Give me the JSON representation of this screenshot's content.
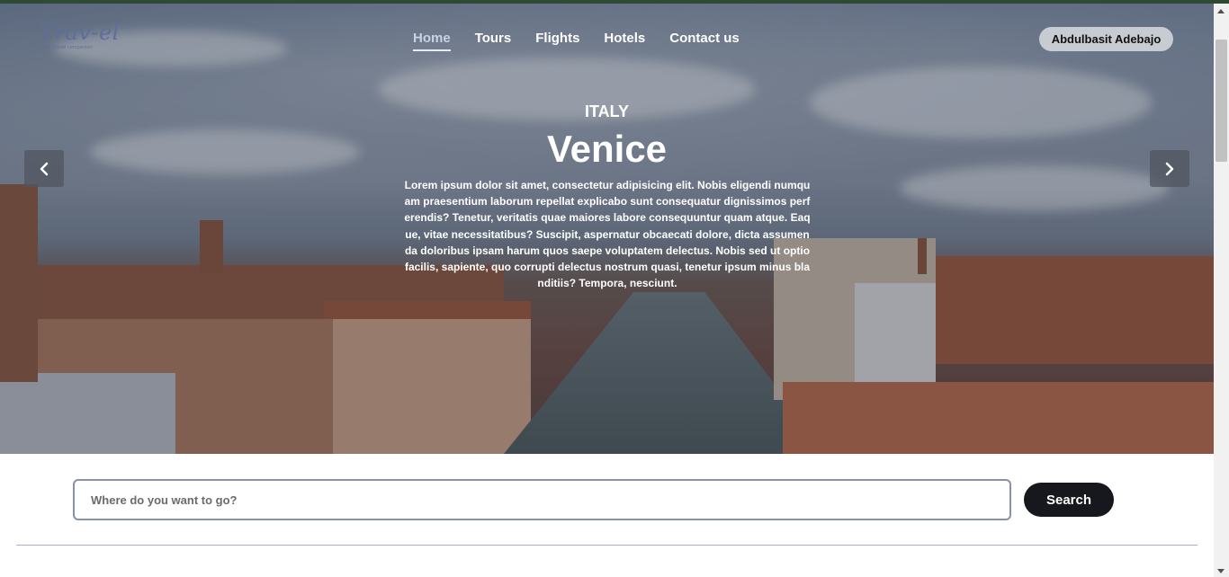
{
  "header": {
    "logo": "Trav-el",
    "logo_tagline": "your travel companion",
    "nav": [
      {
        "label": "Home",
        "active": true
      },
      {
        "label": "Tours",
        "active": false
      },
      {
        "label": "Flights",
        "active": false
      },
      {
        "label": "Hotels",
        "active": false
      },
      {
        "label": "Contact us",
        "active": false
      }
    ],
    "user_name": "Abdulbasit Adebajo"
  },
  "hero": {
    "country": "ITALY",
    "city": "Venice",
    "description": "Lorem ipsum dolor sit amet, consectetur adipisicing elit. Nobis eligendi numquam praesentium laborum repellat explicabo sunt consequatur dignissimos perferendis? Tenetur, veritatis quae maiores labore consequuntur quam atque. Eaque, vitae necessitatibus? Suscipit, aspernatur obcaecati dolore, dicta assumenda doloribus ipsam harum quos saepe voluptatem delectus. Nobis sed ut optio facilis, sapiente, quo corrupti delectus nostrum quasi, tenetur ipsum minus blanditiis? Tempora, nesciunt.",
    "prev_icon": "chevron-left-icon",
    "next_icon": "chevron-right-icon"
  },
  "search": {
    "placeholder": "Where do you want to go?",
    "value": "",
    "button_label": "Search"
  },
  "colors": {
    "accent_dark": "#16181d",
    "logo": "#5e6e9a",
    "input_border": "#8a90a8"
  }
}
